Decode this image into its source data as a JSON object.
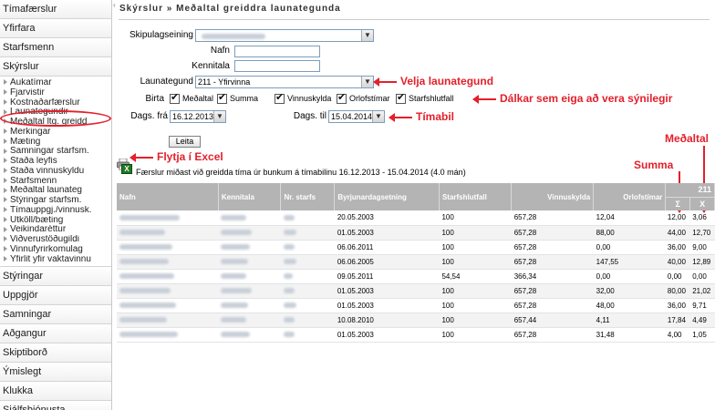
{
  "sidebar": {
    "items_top": [
      "Tímafærslur",
      "Yfirfara",
      "Starfsmenn",
      "Skýrslur"
    ],
    "sub_items": [
      "Aukatímar",
      "Fjarvistir",
      "Kostnaðarfærslur",
      "Launategundir",
      "Meðaltal ltg. greidd",
      "Merkingar",
      "Mæting",
      "Samningar starfsm.",
      "Staða leyfis",
      "Staða vinnuskyldu",
      "Starfsmenn",
      "Meðaltal launateg",
      "Stýringar starfsm.",
      "Tímauppgj./vinnusk.",
      "Útköll/bæting",
      "Veikindaréttur",
      "Viðverustöðugildi",
      "Vinnufyrirkomulag",
      "Yfirlit yfir vaktavinnu"
    ],
    "items_bottom": [
      "Stýringar",
      "Uppgjör",
      "Samningar",
      "Aðgangur",
      "Skiptiborð",
      "Ýmislegt",
      "Klukka",
      "Sjálfsþjónusta"
    ],
    "collapse": "‹"
  },
  "breadcrumb": "Skýrslur » Meðaltal greiddra launategunda",
  "form": {
    "skipulagseining_label": "Skipulagseining",
    "nafn_label": "Nafn",
    "kennitala_label": "Kennitala",
    "launategund_label": "Launategund",
    "launategund_value": "211 - Yfirvinna",
    "birta_label": "Birta",
    "checkboxes": [
      "Meðaltal",
      "Summa",
      "Vinnuskylda",
      "Orlofstímar",
      "Starfshlutfall"
    ],
    "dags_fra_label": "Dags. frá",
    "dags_fra_value": "16.12.2013",
    "dags_til_label": "Dags. til",
    "dags_til_value": "15.04.2014",
    "search_button": "Leita"
  },
  "annotations": {
    "velja": "Velja launategund",
    "dalkar": "Dálkar sem eiga að vera sýnilegir",
    "timabil": "Tímabil",
    "excel": "Flytja í Excel",
    "summa": "Summa",
    "medaltal": "Meðaltal"
  },
  "caption": "Færslur miðast við greidda tíma úr bunkum á tímabilinu 16.12.2013 - 15.04.2014 (4.0 mán)",
  "table": {
    "headers": [
      "Nafn",
      "Kennitala",
      "Nr. starfs",
      "Byrjunardagsetning",
      "Starfshlutfall",
      "Vinnuskylda",
      "Orlofstímar"
    ],
    "code_header": "211",
    "sum_symbol": "Σ",
    "avg_symbol": "X",
    "rows": [
      {
        "start": "20.05.2003",
        "pct": "100",
        "vinnuskylda": "657,28",
        "orlof": "12,04",
        "sum": "12,00",
        "avg": "3,06"
      },
      {
        "start": "01.05.2003",
        "pct": "100",
        "vinnuskylda": "657,28",
        "orlof": "88,00",
        "sum": "44,00",
        "avg": "12,70"
      },
      {
        "start": "06.06.2011",
        "pct": "100",
        "vinnuskylda": "657,28",
        "orlof": "0,00",
        "sum": "36,00",
        "avg": "9,00"
      },
      {
        "start": "06.06.2005",
        "pct": "100",
        "vinnuskylda": "657,28",
        "orlof": "147,55",
        "sum": "40,00",
        "avg": "12,89"
      },
      {
        "start": "09.05.2011",
        "pct": "54,54",
        "vinnuskylda": "366,34",
        "orlof": "0,00",
        "sum": "0,00",
        "avg": "0,00"
      },
      {
        "start": "01.05.2003",
        "pct": "100",
        "vinnuskylda": "657,28",
        "orlof": "32,00",
        "sum": "80,00",
        "avg": "21,02"
      },
      {
        "start": "01.05.2003",
        "pct": "100",
        "vinnuskylda": "657,28",
        "orlof": "48,00",
        "sum": "36,00",
        "avg": "9,71"
      },
      {
        "start": "10.08.2010",
        "pct": "100",
        "vinnuskylda": "657,44",
        "orlof": "4,11",
        "sum": "17,84",
        "avg": "4,49"
      },
      {
        "start": "01.05.2003",
        "pct": "100",
        "vinnuskylda": "657,28",
        "orlof": "31,48",
        "sum": "4,00",
        "avg": "1,05"
      }
    ]
  },
  "colors": {
    "accent_red": "#e3202b",
    "header_gray": "#b4b4b4"
  }
}
